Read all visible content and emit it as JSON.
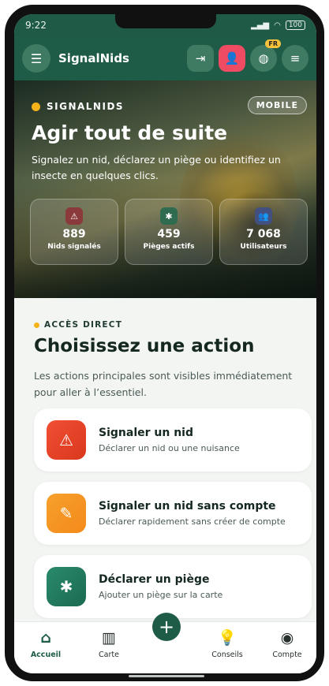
{
  "status_bar": {
    "time": "9:22",
    "battery": "100"
  },
  "app_bar": {
    "brand": "SignalNids",
    "lang_badge": "FR",
    "icons": {
      "menu": "menu-icon",
      "login": "login-icon",
      "add_user": "add-user-icon",
      "globe": "globe-icon",
      "burger": "hamburger-icon"
    }
  },
  "hero": {
    "eyebrow": "SIGNALNIDS",
    "badge": "MOBILE",
    "title": "Agir tout de suite",
    "description": "Signalez un nid, déclarez un piège ou identifiez un insecte en quelques clics.",
    "stats": [
      {
        "value": "889",
        "label": "Nids signalés",
        "icon": "warning-icon"
      },
      {
        "value": "459",
        "label": "Pièges actifs",
        "icon": "bug-icon"
      },
      {
        "value": "7 068",
        "label": "Utilisateurs",
        "icon": "users-icon"
      }
    ]
  },
  "section": {
    "eyebrow": "ACCÈS DIRECT",
    "title": "Choisissez une action",
    "description": "Les actions principales sont visibles immédiatement pour aller à l’essentiel."
  },
  "actions": [
    {
      "title": "Signaler un nid",
      "subtitle": "Déclarer un nid ou une nuisance",
      "icon": "warning-icon"
    },
    {
      "title": "Signaler un nid sans compte",
      "subtitle": "Déclarer rapidement sans créer de compte",
      "icon": "edit-note-icon"
    },
    {
      "title": "Déclarer un piège",
      "subtitle": "Ajouter un piège sur la carte",
      "icon": "bug-icon"
    }
  ],
  "bottom_nav": {
    "items": [
      {
        "label": "Accueil",
        "icon": "home-icon"
      },
      {
        "label": "Carte",
        "icon": "map-icon"
      },
      {
        "label": "Conseils",
        "icon": "lightbulb-icon"
      },
      {
        "label": "Compte",
        "icon": "account-icon"
      }
    ],
    "fab_icon": "plus-icon"
  },
  "colors": {
    "primary": "#1e5c47",
    "accent_red": "#ef4b63",
    "accent_yellow": "#f6b21b",
    "action_red": "#e8442a",
    "action_orange": "#f6962a",
    "action_teal": "#22785d"
  }
}
